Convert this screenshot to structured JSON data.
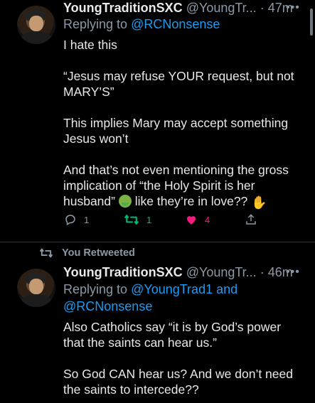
{
  "colors": {
    "background": "#000000",
    "text": "#e7e9ea",
    "secondary": "#8b98a5",
    "link": "#1d9bf0",
    "retweet": "#00ba7c",
    "like": "#f91880"
  },
  "tweets": [
    {
      "name": "YoungTraditionSXC",
      "handle": "@YoungTr...",
      "time": "· 47m",
      "reply_prefix": "Replying to ",
      "reply_to_1": "@RCNonsense",
      "reply_to_2": "",
      "paragraphs": [
        "I hate this",
        "“Jesus may refuse YOUR request, but not MARY’S”",
        "This implies Mary may accept something Jesus won’t",
        "And that’s not even mentioning the gross implication of “the Holy Spirit is her husband”",
        "like they’re in love??"
      ],
      "emoji": [
        "nauseated-face-emoji",
        "raised-hand-emoji"
      ],
      "actions": {
        "replies": "1",
        "retweets": "1",
        "likes": "4"
      }
    },
    {
      "retweet_label": "You Retweeted",
      "name": "YoungTraditionSXC",
      "handle": "@YoungTr...",
      "time": "· 46m",
      "reply_prefix": "Replying to ",
      "reply_to_1": "@YoungTrad1",
      "reply_and": " and",
      "reply_to_2": "@RCNonsense",
      "paragraphs": [
        "Also Catholics say “it is by God’s power that the saints can hear us.”",
        "So God CAN hear us? And we don’t need the saints to intercede??"
      ]
    }
  ],
  "icons": {
    "more": "more-dots-icon",
    "reply": "reply-icon",
    "retweet": "retweet-icon",
    "like": "heart-icon",
    "share": "share-icon"
  }
}
